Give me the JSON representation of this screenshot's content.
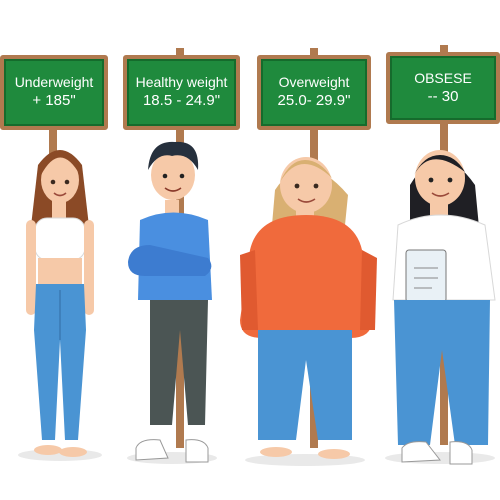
{
  "signs": [
    {
      "title": "Underweight",
      "range": "+ 185\""
    },
    {
      "title": "Healthy weight",
      "range": "18.5 - 24.9\""
    },
    {
      "title": "Overweight",
      "range": "25.0- 29.9\""
    },
    {
      "title": "OBSESE",
      "range": "-- 30"
    }
  ],
  "colors": {
    "sign_board": "#1f8a3d",
    "sign_frame": "#b07a4f",
    "post": "#b07a4f",
    "jeans": "#4a94d3",
    "tshirt_blue": "#4a8fe0",
    "sweater_orange": "#f06a3c",
    "skin": "#f6c9a8"
  }
}
